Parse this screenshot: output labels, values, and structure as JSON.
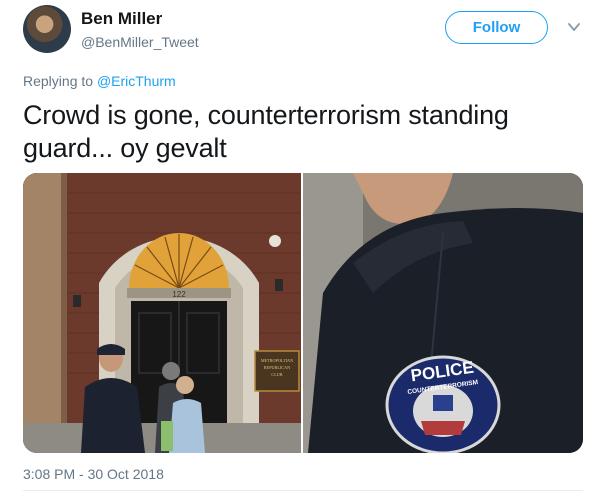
{
  "author": {
    "name": "Ben Miller",
    "handle": "@BenMiller_Tweet"
  },
  "follow_label": "Follow",
  "reply": {
    "prefix": "Replying to ",
    "mention": "@EricThurm"
  },
  "tweet": {
    "line1": "Crowd is gone, counterterrorism standing",
    "line2": "guard... oy gevalt"
  },
  "photos": {
    "plaque_line1": "METROPOLITAN",
    "plaque_line2": "REPUBLICAN",
    "plaque_line3": "CLUB",
    "door_number": "122",
    "patch_top": "POLICE",
    "patch_bottom": "COUNTERTERRORISM"
  },
  "timestamp": "3:08 PM - 30 Oct 2018",
  "colors": {
    "accent": "#1da1f2",
    "secondary_text": "#657786",
    "primary_text": "#14171a"
  }
}
